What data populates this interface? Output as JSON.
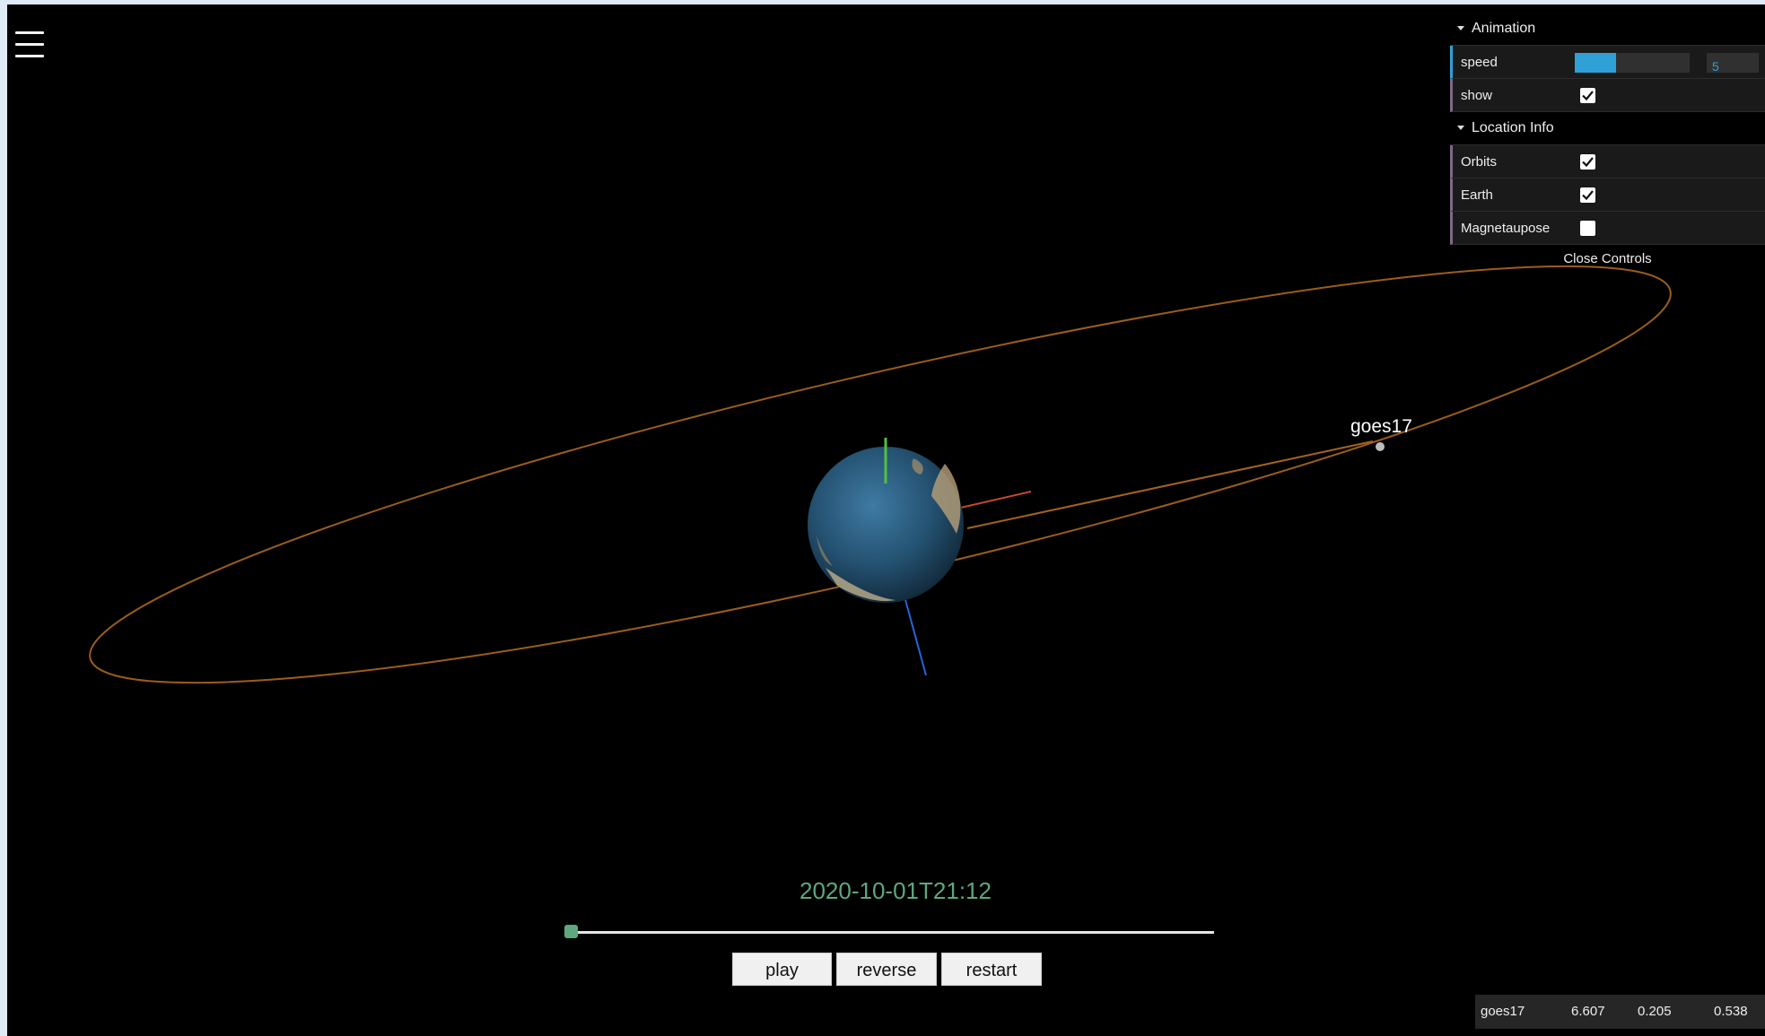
{
  "gui": {
    "animation_title": "Animation",
    "speed_label": "speed",
    "speed_value": "5",
    "speed_fraction": 0.36,
    "show_label": "show",
    "show_checked": true,
    "location_title": "Location Info",
    "orbits_label": "Orbits",
    "orbits_checked": true,
    "earth_label": "Earth",
    "earth_checked": true,
    "magnetopause_label": "Magnetaupose",
    "magnetopause_checked": false,
    "close_label": "Close Controls"
  },
  "scene": {
    "satellite_name": "goes17",
    "colors": {
      "orbit": "#a3621e",
      "x_axis": "#c24a2a",
      "y_axis": "#52c23a",
      "z_axis": "#2a62d9",
      "ocean": "#2a5a82"
    }
  },
  "timeline": {
    "timestamp": "2020-10-01T21:12",
    "progress": 0.0
  },
  "buttons": {
    "play": "play",
    "reverse": "reverse",
    "restart": "restart"
  },
  "info": {
    "name": "goes17",
    "v1": "6.607",
    "v2": "0.205",
    "v3": "0.538"
  }
}
